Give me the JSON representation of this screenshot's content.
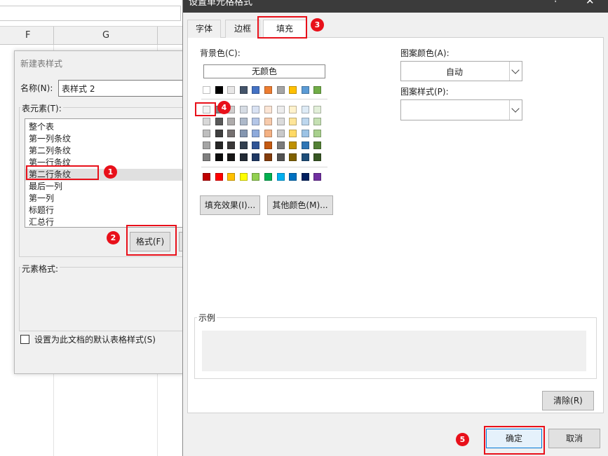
{
  "excel": {
    "columns": [
      "F",
      "G"
    ]
  },
  "style_dialog": {
    "title": "新建表样式",
    "name_label": "名称(N):",
    "name_value": "表样式 2",
    "elements_label": "表元素(T):",
    "elements": [
      "整个表",
      "第一列条纹",
      "第二列条纹",
      "第一行条纹",
      "第二行条纹",
      "最后一列",
      "第一列",
      "标题行",
      "汇总行"
    ],
    "selected_element": "第二行条纹",
    "format_button": "格式(F)",
    "element_format_label": "元素格式:",
    "default_checkbox_label": "设置为此文档的默认表格样式(S)"
  },
  "format_dialog": {
    "title": "设置单元格格式",
    "help": "?",
    "close": "✕",
    "tabs": [
      {
        "label": "字体",
        "active": false
      },
      {
        "label": "边框",
        "active": false
      },
      {
        "label": "填充",
        "active": true
      }
    ],
    "bg_color_label": "背景色(C):",
    "no_color": "无颜色",
    "theme_top_row": [
      "#ffffff",
      "#000000",
      "#e7e6e6",
      "#44546a",
      "#4472c4",
      "#ed7d31",
      "#a5a5a5",
      "#ffc000",
      "#5b9bd5",
      "#70ad47"
    ],
    "theme_shades": [
      [
        "#f2f2f2",
        "#7f7f7f",
        "#d0cece",
        "#d6dce4",
        "#d9e2f3",
        "#fbe5d5",
        "#ededed",
        "#fff2cc",
        "#deebf6",
        "#e2efd9"
      ],
      [
        "#d8d8d8",
        "#595959",
        "#aeabab",
        "#adb9ca",
        "#b4c6e7",
        "#f7cbac",
        "#dbdbdb",
        "#fee599",
        "#bdd7ee",
        "#c5e0b3"
      ],
      [
        "#bfbfbf",
        "#3f3f3f",
        "#757070",
        "#8496b0",
        "#8eaadb",
        "#f4b183",
        "#c9c9c9",
        "#ffd965",
        "#9cc3e5",
        "#a8d08d"
      ],
      [
        "#a5a5a5",
        "#262626",
        "#3a3838",
        "#323f4f",
        "#2f5496",
        "#c55a11",
        "#7b7b7b",
        "#bf9000",
        "#2e75b5",
        "#538135"
      ],
      [
        "#7f7f7f",
        "#0c0c0c",
        "#171616",
        "#222a35",
        "#1f3864",
        "#833c0b",
        "#525252",
        "#7f6000",
        "#1e4e79",
        "#375623"
      ]
    ],
    "standard_colors": [
      "#c00000",
      "#ff0000",
      "#ffc000",
      "#ffff00",
      "#92d050",
      "#00b050",
      "#00b0f0",
      "#0070c0",
      "#002060",
      "#7030a0"
    ],
    "selected_swatch": "#f2f2f2",
    "fill_effects_button": "填充效果(I)...",
    "more_colors_button": "其他颜色(M)...",
    "pattern_color_label": "图案颜色(A):",
    "pattern_color_value": "自动",
    "pattern_style_label": "图案样式(P):",
    "pattern_style_value": "",
    "sample_label": "示例",
    "clear_button": "清除(R)",
    "ok_button": "确定",
    "cancel_button": "取消"
  },
  "annotations": {
    "badges": [
      "1",
      "2",
      "3",
      "4",
      "5"
    ],
    "color": "#e8101a"
  }
}
